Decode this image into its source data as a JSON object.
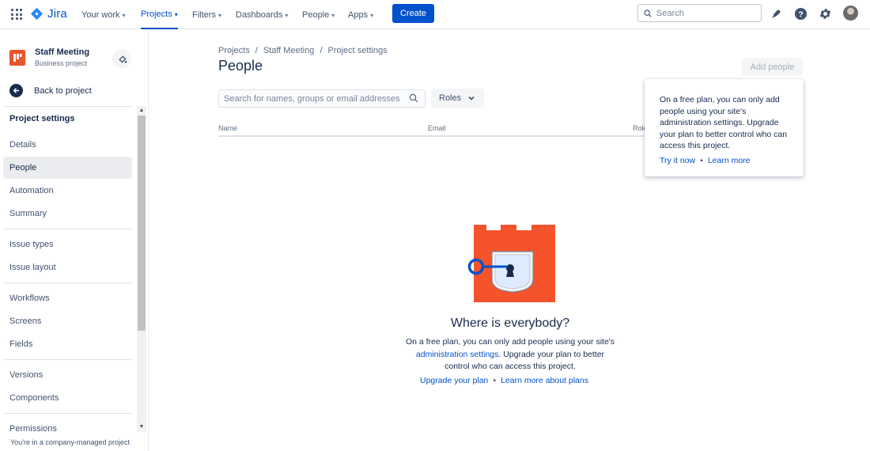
{
  "topnav": {
    "logo_text": "Jira",
    "items": [
      {
        "label": "Your work"
      },
      {
        "label": "Projects"
      },
      {
        "label": "Filters"
      },
      {
        "label": "Dashboards"
      },
      {
        "label": "People"
      },
      {
        "label": "Apps"
      }
    ],
    "create_label": "Create",
    "search_placeholder": "Search",
    "accent_color": "#0052cc"
  },
  "sidebar": {
    "project_name": "Staff Meeting",
    "project_type": "Business project",
    "back_label": "Back to project",
    "section_title": "Project settings",
    "items": [
      {
        "label": "Details"
      },
      {
        "label": "People"
      },
      {
        "label": "Automation"
      },
      {
        "label": "Summary"
      },
      {
        "label": "Issue types"
      },
      {
        "label": "Issue layout"
      },
      {
        "label": "Workflows"
      },
      {
        "label": "Screens"
      },
      {
        "label": "Fields"
      },
      {
        "label": "Versions"
      },
      {
        "label": "Components"
      },
      {
        "label": "Permissions"
      }
    ],
    "footer_note": "You're in a company-managed project"
  },
  "main": {
    "breadcrumb": [
      "Projects",
      "Staff Meeting",
      "Project settings"
    ],
    "breadcrumb_separator": "/",
    "title": "People",
    "add_people_label": "Add people",
    "search_placeholder": "Search for names, groups or email addresses",
    "roles_label": "Roles",
    "columns": [
      "Name",
      "Email",
      "Role"
    ],
    "tooltip": {
      "text": "On a free plan, you can only add people using your site's administration settings. Upgrade your plan to better control who can access this project.",
      "link_try": "Try it now",
      "link_learn": "Learn more",
      "separator": "•"
    },
    "empty_state": {
      "title": "Where is everybody?",
      "desc_before": "On a free plan, you can only add people using your site's ",
      "desc_link": "administration settings",
      "desc_after": ". Upgrade your plan to better control who can access this project.",
      "link_upgrade": "Upgrade your plan",
      "link_learn": "Learn more about plans",
      "separator": "•",
      "illustration_color": "#f4532c"
    }
  }
}
